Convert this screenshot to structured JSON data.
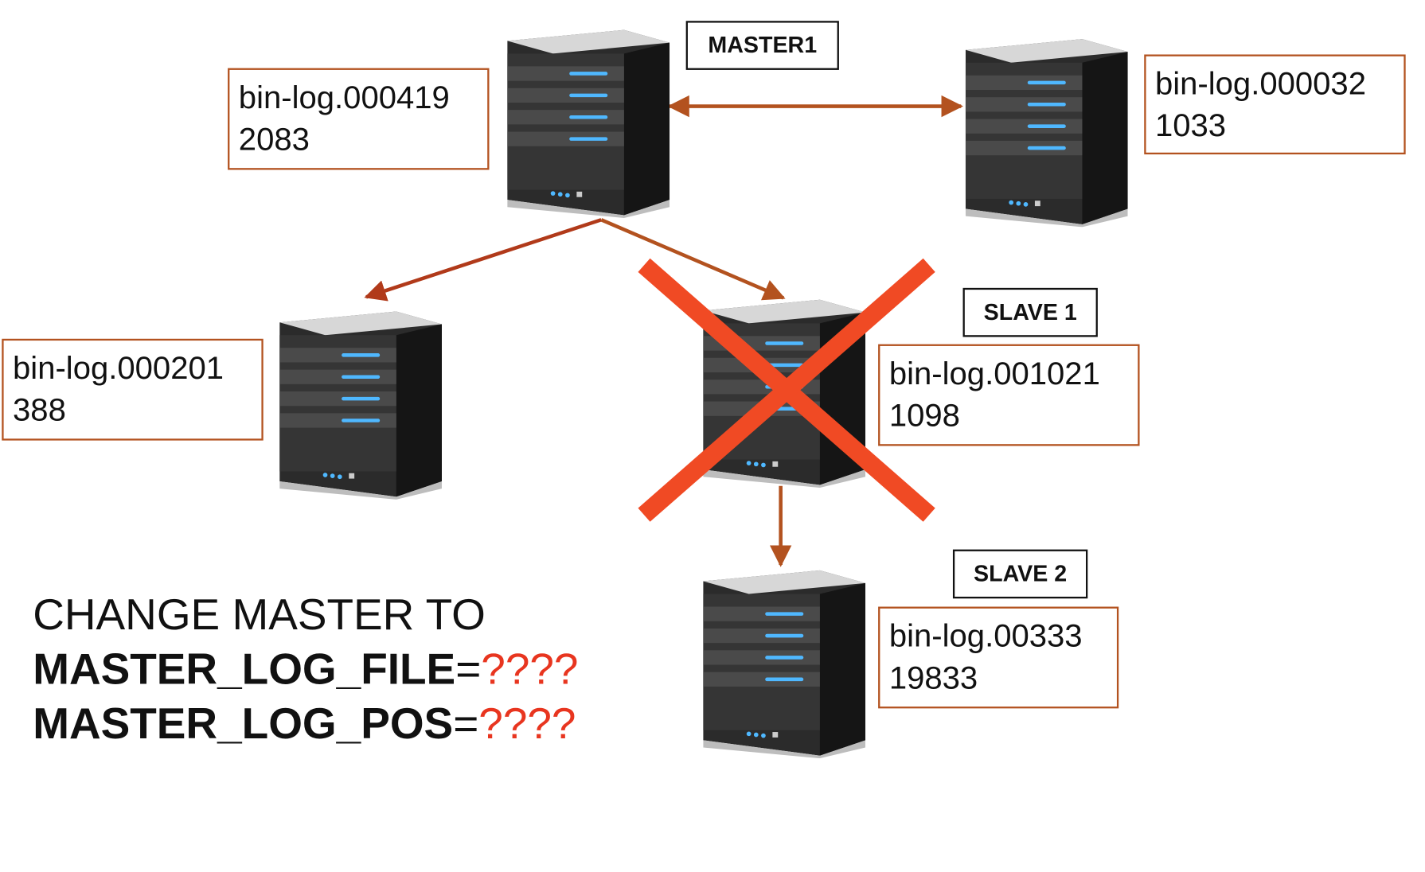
{
  "labels": {
    "master1": "MASTER1",
    "slave1": "SLAVE 1",
    "slave2": "SLAVE 2"
  },
  "logs": {
    "master1": {
      "file": "bin-log.000419",
      "pos": "2083"
    },
    "peer": {
      "file": "bin-log.000032",
      "pos": "1033"
    },
    "left_slave": {
      "file": "bin-log.000201",
      "pos": "388"
    },
    "slave1": {
      "file": "bin-log.001021",
      "pos": "1098"
    },
    "slave2": {
      "file": "bin-log.00333",
      "pos": "19833"
    }
  },
  "command": {
    "line1": "CHANGE MASTER TO",
    "log_file_key": "MASTER_LOG_FILE",
    "log_pos_key": "MASTER_LOG_POS",
    "equals": "=",
    "unknown": "????"
  },
  "colors": {
    "box_border": "#b3521f",
    "arrow": "#b3521f",
    "arrow_dark": "#b13a1a",
    "failure_cross": "#f04a24",
    "unknown_text": "#e8351f"
  },
  "icons": {
    "server": "server-tower-icon",
    "failure": "red-x-icon"
  }
}
